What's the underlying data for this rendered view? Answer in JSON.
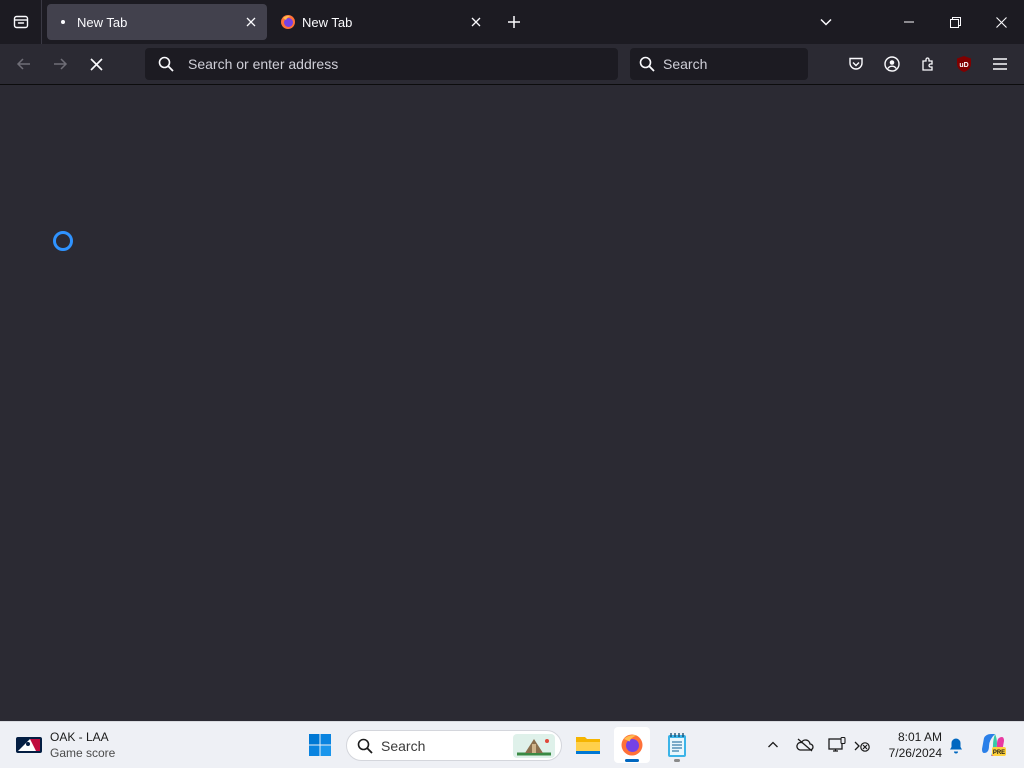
{
  "browser": {
    "tabs": [
      {
        "label": "New Tab",
        "active": true
      },
      {
        "label": "New Tab",
        "active": false
      }
    ],
    "urlbar_placeholder": "Search or enter address",
    "searchbar_placeholder": "Search",
    "extension_badge": "uD",
    "accent_color": "#2f93ff"
  },
  "taskbar": {
    "widget": {
      "line1": "OAK - LAA",
      "line2": "Game score"
    },
    "search_label": "Search",
    "apps": [
      "start-icon",
      "file-explorer-icon",
      "firefox-icon",
      "notepad-icon"
    ],
    "clock": {
      "time": "8:01 AM",
      "date": "7/26/2024"
    },
    "copilot_badge": "PRE"
  }
}
